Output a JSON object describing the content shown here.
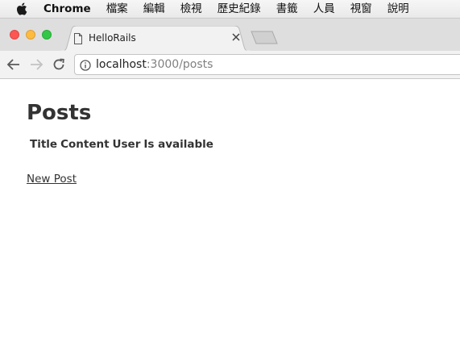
{
  "menubar": {
    "app_name": "Chrome",
    "items": [
      "檔案",
      "編輯",
      "檢視",
      "歷史紀錄",
      "書籤",
      "人員",
      "視窗",
      "說明"
    ]
  },
  "tab": {
    "title": "HelloRails"
  },
  "address_bar": {
    "host": "localhost",
    "rest": ":3000/posts"
  },
  "page": {
    "heading": "Posts",
    "table_headers": [
      "Title",
      "Content",
      "User",
      "Is available"
    ],
    "new_post_link": "New Post"
  },
  "colors": {
    "close": "#fc5753",
    "minimize": "#fdbc40",
    "maximize": "#33c748"
  }
}
